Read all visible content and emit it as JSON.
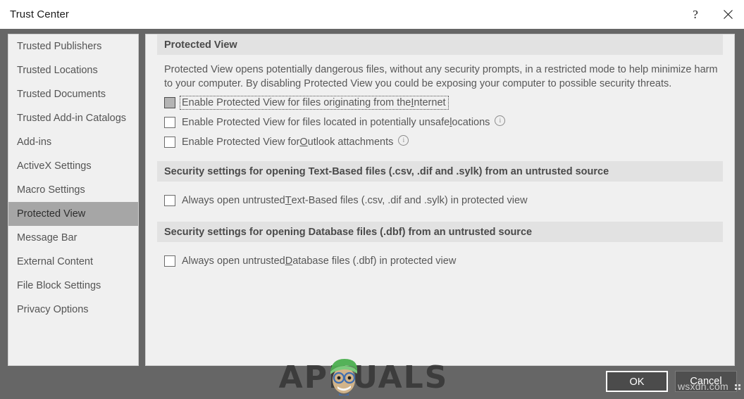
{
  "window": {
    "title": "Trust Center",
    "help_label": "?",
    "close_label": "Close",
    "help_icon": "question-mark-icon",
    "close_icon": "close-x-icon"
  },
  "sidebar": {
    "items": [
      {
        "label": "Trusted Publishers",
        "selected": false
      },
      {
        "label": "Trusted Locations",
        "selected": false
      },
      {
        "label": "Trusted Documents",
        "selected": false
      },
      {
        "label": "Trusted Add-in Catalogs",
        "selected": false
      },
      {
        "label": "Add-ins",
        "selected": false
      },
      {
        "label": "ActiveX Settings",
        "selected": false
      },
      {
        "label": "Macro Settings",
        "selected": false
      },
      {
        "label": "Protected View",
        "selected": true
      },
      {
        "label": "Message Bar",
        "selected": false
      },
      {
        "label": "External Content",
        "selected": false
      },
      {
        "label": "File Block Settings",
        "selected": false
      },
      {
        "label": "Privacy Options",
        "selected": false
      }
    ]
  },
  "main": {
    "section1": {
      "header": "Protected View",
      "description": "Protected View opens potentially dangerous files, without any security prompts, in a restricted mode to help minimize harm to your computer. By disabling Protected View you could be exposing your computer to possible security threats.",
      "options": [
        {
          "label_before": "Enable Protected View for files originating from the ",
          "accel": "I",
          "label_after": "nternet",
          "checked": false,
          "hover": true,
          "focused": true,
          "info": false
        },
        {
          "label_before": "Enable Protected View for files located in potentially unsafe ",
          "accel": "l",
          "label_after": "ocations",
          "checked": false,
          "hover": false,
          "focused": false,
          "info": true
        },
        {
          "label_before": "Enable Protected View for ",
          "accel": "O",
          "label_after": "utlook attachments",
          "checked": false,
          "hover": false,
          "focused": false,
          "info": true
        }
      ]
    },
    "section2": {
      "header": "Security settings for opening Text-Based files (.csv, .dif and .sylk) from an untrusted source",
      "options": [
        {
          "label_before": "Always open untrusted ",
          "accel": "T",
          "label_after": "ext-Based files (.csv, .dif and .sylk) in protected view",
          "checked": false,
          "hover": false,
          "focused": false,
          "info": false
        }
      ]
    },
    "section3": {
      "header": "Security settings for opening Database files (.dbf) from an untrusted source",
      "options": [
        {
          "label_before": "Always open untrusted ",
          "accel": "D",
          "label_after": "atabase files (.dbf) in protected view",
          "checked": false,
          "hover": false,
          "focused": false,
          "info": false
        }
      ]
    }
  },
  "footer": {
    "ok_label": "OK",
    "cancel_label": "Cancel"
  },
  "watermarks": {
    "appuals": "APPUALS",
    "wsxdn": "wsxdn.com"
  },
  "colors": {
    "dialog_background": "#666666",
    "panel_background": "#f0f0f0",
    "section_header_background": "#e2e2e2",
    "selected_nav_background": "#a6a6a6",
    "titlebar_background": "#ffffff",
    "button_background": "#4a4a4a",
    "text": "#575757"
  }
}
